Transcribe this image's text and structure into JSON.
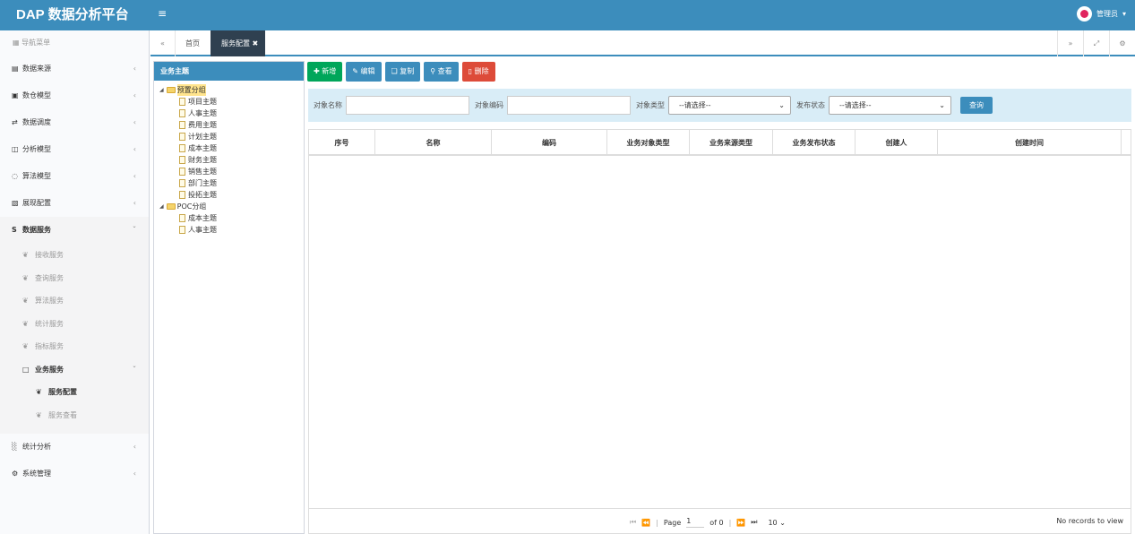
{
  "app": {
    "title": "DAP 数据分析平台",
    "user": "管理员"
  },
  "sidebar": {
    "header": "导航菜单",
    "items": [
      {
        "label": "数据来源",
        "icon": "database-icon"
      },
      {
        "label": "数仓模型",
        "icon": "cubes-icon"
      },
      {
        "label": "数据调度",
        "icon": "random-icon"
      },
      {
        "label": "分析模型",
        "icon": "sitemap-icon"
      },
      {
        "label": "算法模型",
        "icon": "spinner-icon"
      },
      {
        "label": "展现配置",
        "icon": "film-icon"
      },
      {
        "label": "数据服务",
        "icon": "dollar-icon"
      }
    ],
    "services": {
      "items": [
        {
          "label": "接收服务"
        },
        {
          "label": "查询服务"
        },
        {
          "label": "算法服务"
        },
        {
          "label": "统计服务"
        },
        {
          "label": "指标服务"
        },
        {
          "label": "业务服务"
        }
      ],
      "business": [
        {
          "label": "服务配置"
        },
        {
          "label": "服务查看"
        }
      ]
    },
    "bottom": [
      {
        "label": "统计分析",
        "icon": "bar-chart-icon"
      },
      {
        "label": "系统管理",
        "icon": "gear-icon"
      }
    ]
  },
  "tabs": {
    "home": "首页",
    "active": "服务配置"
  },
  "tree": {
    "title": "业务主题",
    "groups": [
      {
        "label": "预置分组",
        "children": [
          "项目主题",
          "人事主题",
          "费用主题",
          "计划主题",
          "成本主题",
          "财务主题",
          "销售主题",
          "部门主题",
          "投拓主题"
        ]
      },
      {
        "label": "POC分组",
        "children": [
          "成本主题",
          "人事主题"
        ]
      }
    ]
  },
  "toolbar": {
    "add": "新增",
    "edit": "编辑",
    "copy": "复制",
    "view": "查看",
    "delete": "删除"
  },
  "search": {
    "name_label": "对象名称",
    "code_label": "对象编码",
    "type_label": "对象类型",
    "type_value": "--请选择--",
    "status_label": "发布状态",
    "status_value": "--请选择--",
    "query": "查询"
  },
  "grid": {
    "columns": [
      "序号",
      "名称",
      "编码",
      "业务对象类型",
      "业务来源类型",
      "业务发布状态",
      "创建人",
      "创建时间"
    ],
    "pager": {
      "page_label": "Page",
      "page": "1",
      "of": "of 0",
      "page_size": "10",
      "records": "No records to view"
    }
  },
  "colors": {
    "primary": "#3c8dbc",
    "success": "#00a65a",
    "danger": "#dd4b39",
    "dark_tab": "#2f4050"
  }
}
